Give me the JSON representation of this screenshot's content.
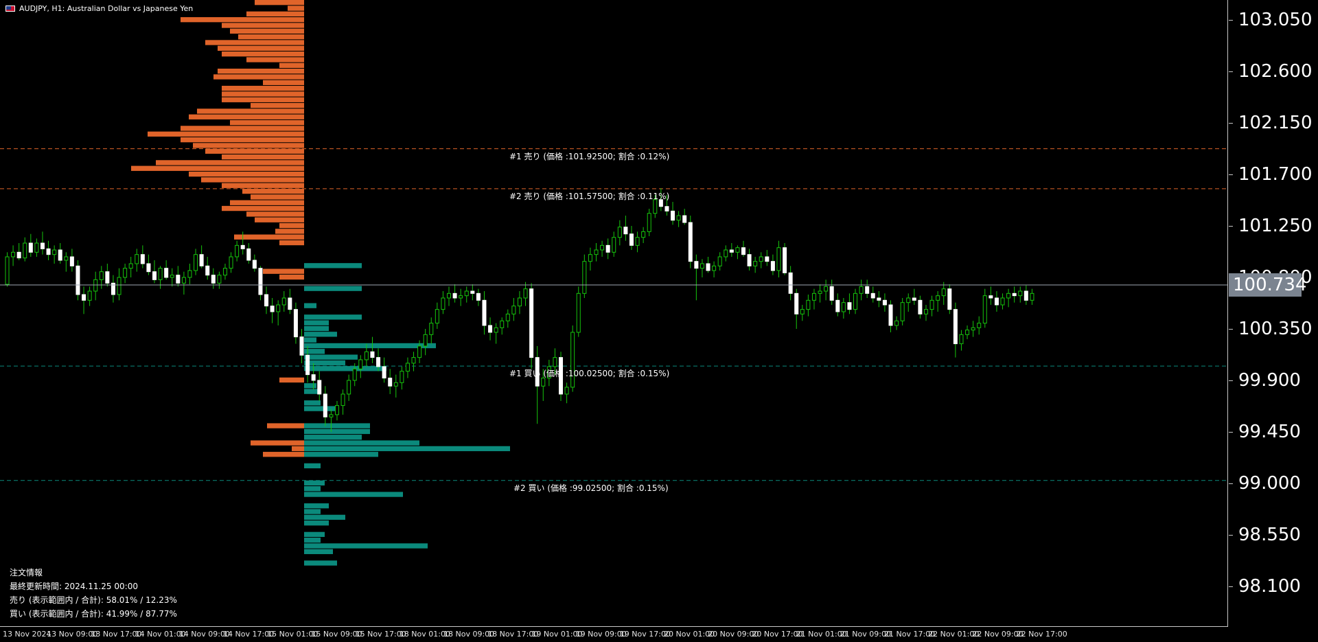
{
  "window": {
    "title": "AUDJPY, H1:  Australian Dollar vs Japanese Yen",
    "symbol_icon": "au-flag-icon"
  },
  "colors": {
    "sell": "#e0642a",
    "buy": "#0b8a7c",
    "bull_candle": "#000000",
    "bull_border": "#ffffff",
    "bear_candle": "#ffffff",
    "wick": "#16c60c",
    "grid_sell_line": "#e0642a",
    "grid_buy_line": "#0b8a7c",
    "current_price_line": "#a0a8b4",
    "background": "#000000"
  },
  "price_axis": {
    "labels": [
      "103.050",
      "102.600",
      "102.150",
      "101.700",
      "101.250",
      "100.800",
      "100.350",
      "99.900",
      "99.450",
      "99.000",
      "98.550",
      "98.100"
    ],
    "current_price": "100.734"
  },
  "time_axis": {
    "labels": [
      "13 Nov 2024",
      "13 Nov 09:00",
      "13 Nov 17:00",
      "14 Nov 01:00",
      "14 Nov 09:00",
      "14 Nov 17:00",
      "15 Nov 01:00",
      "15 Nov 09:00",
      "15 Nov 17:00",
      "18 Nov 01:00",
      "18 Nov 09:00",
      "18 Nov 17:00",
      "19 Nov 01:00",
      "19 Nov 09:00",
      "19 Nov 17:00",
      "20 Nov 01:00",
      "20 Nov 09:00",
      "20 Nov 17:00",
      "21 Nov 01:00",
      "21 Nov 09:00",
      "21 Nov 17:00",
      "22 Nov 01:00",
      "22 Nov 09:00",
      "22 Nov 17:00"
    ]
  },
  "order_lines": [
    {
      "text": "#1 売り (価格 :101.92500; 割合 :0.12%)",
      "price": 101.925,
      "side": "sell"
    },
    {
      "text": "#2 売り (価格 :101.57500; 割合 :0.11%)",
      "price": 101.575,
      "side": "sell"
    },
    {
      "text": "#1 買い (価格 :100.02500; 割合 :0.15%)",
      "price": 100.025,
      "side": "buy"
    },
    {
      "text": "#2 買い (価格 :99.02500; 割合 :0.15%)",
      "price": 99.025,
      "side": "buy"
    }
  ],
  "info_panel": {
    "heading": "注文情報",
    "last_update": "最終更新時間: 2024.11.25 00:00",
    "sell_summary": "売り (表示範囲内 / 合計): 58.01% / 12.23%",
    "buy_summary": "買い (表示範囲内 / 合計): 41.99% / 87.77%"
  },
  "order_book": {
    "price_top": 103.225,
    "step": 0.05,
    "sell_levels": [
      0.12,
      0.04,
      0.14,
      0.3,
      0.2,
      0.18,
      0.16,
      0.24,
      0.21,
      0.2,
      0.14,
      0.06,
      0.21,
      0.22,
      0.1,
      0.2,
      0.2,
      0.2,
      0.13,
      0.26,
      0.28,
      0.18,
      0.3,
      0.38,
      0.3,
      0.27,
      0.24,
      0.2,
      0.36,
      0.42,
      0.28,
      0.25,
      0.2,
      0.15,
      0.13,
      0.18,
      0.2,
      0.14,
      0.12,
      0.06,
      0.07,
      0.17,
      0.06,
      0.0,
      0.0,
      0.0,
      0.0,
      0.1,
      0.06,
      0.0,
      0.0,
      0.0,
      0.0,
      0.0,
      0.0,
      0.0,
      0.0,
      0.0,
      0.0,
      0.0,
      0.0,
      0.0,
      0.0,
      0.0,
      0.0,
      0.0,
      0.06,
      0.0,
      0.0,
      0.0,
      0.0,
      0.0,
      0.0,
      0.0,
      0.09,
      0.0,
      0.0,
      0.13,
      0.03,
      0.1,
      0.0,
      0.0,
      0.0,
      0.0,
      0.0,
      0.0,
      0.0,
      0.0,
      0.0,
      0.0,
      0.0,
      0.0,
      0.0,
      0.0,
      0.0,
      0.0,
      0.0,
      0.0,
      0.0,
      0.0,
      0.0,
      0.0,
      0.0,
      0.0,
      0.0,
      0.0,
      0.0,
      0.0,
      0.0,
      0.0,
      0.02
    ],
    "buy_levels": [
      0.0,
      0.0,
      0.0,
      0.0,
      0.0,
      0.0,
      0.0,
      0.0,
      0.0,
      0.0,
      0.0,
      0.0,
      0.0,
      0.0,
      0.0,
      0.0,
      0.0,
      0.0,
      0.0,
      0.0,
      0.0,
      0.0,
      0.0,
      0.0,
      0.0,
      0.0,
      0.0,
      0.0,
      0.0,
      0.0,
      0.0,
      0.0,
      0.0,
      0.0,
      0.0,
      0.0,
      0.0,
      0.0,
      0.0,
      0.0,
      0.0,
      0.0,
      0.0,
      0.0,
      0.0,
      0.0,
      0.14,
      0.0,
      0.0,
      0.0,
      0.14,
      0.0,
      0.0,
      0.03,
      0.0,
      0.14,
      0.06,
      0.06,
      0.08,
      0.03,
      0.32,
      0.05,
      0.13,
      0.1,
      0.2,
      0.0,
      0.0,
      0.03,
      0.04,
      0.0,
      0.04,
      0.08,
      0.0,
      0.0,
      0.16,
      0.16,
      0.14,
      0.28,
      0.5,
      0.18,
      0.0,
      0.04,
      0.0,
      0.0,
      0.05,
      0.04,
      0.24,
      0.0,
      0.06,
      0.04,
      0.1,
      0.06,
      0.0,
      0.05,
      0.04,
      0.3,
      0.07,
      0.0,
      0.08
    ],
    "max_fraction": 0.5,
    "max_width": 300
  },
  "candles": [
    [
      100.74,
      101.02,
      100.72,
      100.98
    ],
    [
      100.98,
      101.08,
      100.9,
      101.02
    ],
    [
      101.02,
      101.1,
      100.95,
      100.97
    ],
    [
      100.97,
      101.15,
      100.94,
      101.1
    ],
    [
      101.1,
      101.18,
      100.98,
      101.02
    ],
    [
      101.02,
      101.14,
      100.98,
      101.1
    ],
    [
      101.1,
      101.2,
      101.0,
      101.05
    ],
    [
      101.05,
      101.12,
      100.95,
      101.0
    ],
    [
      101.0,
      101.08,
      100.92,
      101.04
    ],
    [
      101.04,
      101.1,
      100.92,
      100.95
    ],
    [
      100.95,
      101.02,
      100.85,
      100.98
    ],
    [
      100.98,
      101.05,
      100.85,
      100.9
    ],
    [
      100.9,
      100.95,
      100.6,
      100.65
    ],
    [
      100.65,
      100.72,
      100.48,
      100.6
    ],
    [
      100.6,
      100.72,
      100.55,
      100.68
    ],
    [
      100.68,
      100.85,
      100.6,
      100.78
    ],
    [
      100.78,
      100.9,
      100.7,
      100.85
    ],
    [
      100.85,
      100.92,
      100.72,
      100.75
    ],
    [
      100.75,
      100.82,
      100.58,
      100.65
    ],
    [
      100.65,
      100.88,
      100.6,
      100.8
    ],
    [
      100.8,
      100.92,
      100.75,
      100.88
    ],
    [
      100.88,
      100.98,
      100.8,
      100.92
    ],
    [
      100.92,
      101.05,
      100.85,
      101.0
    ],
    [
      101.0,
      101.08,
      100.88,
      100.92
    ],
    [
      100.92,
      101.0,
      100.82,
      100.85
    ],
    [
      100.85,
      100.95,
      100.75,
      100.78
    ],
    [
      100.78,
      100.9,
      100.7,
      100.88
    ],
    [
      100.88,
      100.95,
      100.78,
      100.8
    ],
    [
      100.8,
      100.88,
      100.72,
      100.82
    ],
    [
      100.82,
      100.9,
      100.72,
      100.75
    ],
    [
      100.75,
      100.85,
      100.65,
      100.8
    ],
    [
      100.8,
      100.92,
      100.74,
      100.86
    ],
    [
      100.86,
      101.05,
      100.82,
      101.0
    ],
    [
      101.0,
      101.08,
      100.88,
      100.9
    ],
    [
      100.9,
      100.98,
      100.78,
      100.82
    ],
    [
      100.82,
      100.88,
      100.7,
      100.75
    ],
    [
      100.75,
      100.85,
      100.7,
      100.82
    ],
    [
      100.82,
      100.92,
      100.78,
      100.88
    ],
    [
      100.88,
      101.02,
      100.84,
      100.98
    ],
    [
      100.98,
      101.12,
      100.94,
      101.08
    ],
    [
      101.08,
      101.2,
      101.0,
      101.05
    ],
    [
      101.05,
      101.1,
      100.92,
      100.95
    ],
    [
      100.95,
      101.0,
      100.85,
      100.88
    ],
    [
      100.88,
      100.9,
      100.6,
      100.65
    ],
    [
      100.65,
      100.72,
      100.48,
      100.55
    ],
    [
      100.55,
      100.62,
      100.4,
      100.5
    ],
    [
      100.5,
      100.6,
      100.38,
      100.56
    ],
    [
      100.56,
      100.68,
      100.5,
      100.62
    ],
    [
      100.62,
      100.7,
      100.48,
      100.52
    ],
    [
      100.52,
      100.58,
      100.22,
      100.28
    ],
    [
      100.28,
      100.35,
      100.05,
      100.12
    ],
    [
      100.12,
      100.2,
      99.88,
      99.95
    ],
    [
      99.95,
      100.05,
      99.82,
      99.9
    ],
    [
      99.9,
      99.98,
      99.72,
      99.78
    ],
    [
      99.78,
      99.85,
      99.5,
      99.58
    ],
    [
      99.58,
      99.65,
      99.45,
      99.6
    ],
    [
      99.6,
      99.72,
      99.55,
      99.68
    ],
    [
      99.68,
      99.82,
      99.6,
      99.78
    ],
    [
      99.78,
      99.95,
      99.72,
      99.9
    ],
    [
      99.9,
      100.05,
      99.85,
      100.0
    ],
    [
      100.0,
      100.12,
      99.92,
      100.08
    ],
    [
      100.08,
      100.22,
      100.02,
      100.15
    ],
    [
      100.15,
      100.28,
      100.05,
      100.1
    ],
    [
      100.1,
      100.18,
      99.98,
      100.02
    ],
    [
      100.02,
      100.1,
      99.88,
      99.92
    ],
    [
      99.92,
      100.0,
      99.78,
      99.85
    ],
    [
      99.85,
      99.95,
      99.75,
      99.88
    ],
    [
      99.88,
      100.02,
      99.82,
      99.98
    ],
    [
      99.98,
      100.1,
      99.92,
      100.05
    ],
    [
      100.05,
      100.15,
      99.98,
      100.1
    ],
    [
      100.1,
      100.25,
      100.05,
      100.2
    ],
    [
      100.2,
      100.35,
      100.12,
      100.3
    ],
    [
      100.3,
      100.45,
      100.22,
      100.4
    ],
    [
      100.4,
      100.58,
      100.35,
      100.52
    ],
    [
      100.52,
      100.68,
      100.48,
      100.62
    ],
    [
      100.62,
      100.72,
      100.55,
      100.66
    ],
    [
      100.66,
      100.74,
      100.58,
      100.62
    ],
    [
      100.62,
      100.7,
      100.55,
      100.64
    ],
    [
      100.64,
      100.72,
      100.58,
      100.68
    ],
    [
      100.68,
      100.74,
      100.6,
      100.66
    ],
    [
      100.66,
      100.7,
      100.55,
      100.6
    ],
    [
      100.6,
      100.68,
      100.3,
      100.38
    ],
    [
      100.38,
      100.45,
      100.25,
      100.32
    ],
    [
      100.32,
      100.4,
      100.22,
      100.36
    ],
    [
      100.36,
      100.45,
      100.3,
      100.42
    ],
    [
      100.42,
      100.52,
      100.36,
      100.48
    ],
    [
      100.48,
      100.62,
      100.42,
      100.55
    ],
    [
      100.55,
      100.68,
      100.48,
      100.62
    ],
    [
      100.62,
      100.76,
      100.55,
      100.7
    ],
    [
      100.7,
      100.75,
      100.0,
      100.1
    ],
    [
      100.1,
      100.2,
      99.52,
      99.85
    ],
    [
      99.85,
      100.0,
      99.72,
      99.92
    ],
    [
      99.92,
      100.08,
      99.85,
      100.02
    ],
    [
      100.02,
      100.18,
      99.95,
      100.1
    ],
    [
      100.1,
      100.15,
      99.72,
      99.78
    ],
    [
      99.78,
      99.88,
      99.7,
      99.84
    ],
    [
      99.84,
      100.38,
      99.8,
      100.32
    ],
    [
      100.32,
      100.72,
      100.28,
      100.66
    ],
    [
      100.66,
      101.0,
      100.62,
      100.94
    ],
    [
      100.94,
      101.06,
      100.86,
      101.0
    ],
    [
      101.0,
      101.1,
      100.94,
      101.04
    ],
    [
      101.04,
      101.12,
      100.98,
      101.08
    ],
    [
      101.08,
      101.14,
      100.96,
      101.02
    ],
    [
      101.02,
      101.2,
      100.98,
      101.15
    ],
    [
      101.15,
      101.3,
      101.08,
      101.24
    ],
    [
      101.24,
      101.34,
      101.12,
      101.18
    ],
    [
      101.18,
      101.25,
      101.04,
      101.08
    ],
    [
      101.08,
      101.2,
      101.02,
      101.15
    ],
    [
      101.15,
      101.24,
      101.1,
      101.2
    ],
    [
      101.2,
      101.4,
      101.16,
      101.36
    ],
    [
      101.36,
      101.52,
      101.32,
      101.48
    ],
    [
      101.48,
      101.58,
      101.38,
      101.42
    ],
    [
      101.42,
      101.52,
      101.34,
      101.38
    ],
    [
      101.38,
      101.46,
      101.26,
      101.3
    ],
    [
      101.3,
      101.38,
      101.24,
      101.34
    ],
    [
      101.34,
      101.4,
      101.26,
      101.28
    ],
    [
      101.28,
      101.34,
      100.88,
      100.94
    ],
    [
      100.94,
      101.0,
      100.6,
      100.88
    ],
    [
      100.88,
      100.96,
      100.8,
      100.92
    ],
    [
      100.92,
      100.98,
      100.84,
      100.86
    ],
    [
      100.86,
      100.94,
      100.8,
      100.9
    ],
    [
      100.9,
      101.02,
      100.86,
      100.98
    ],
    [
      100.98,
      101.08,
      100.94,
      101.04
    ],
    [
      101.04,
      101.1,
      100.98,
      101.02
    ],
    [
      101.02,
      101.08,
      100.96,
      101.06
    ],
    [
      101.06,
      101.12,
      100.98,
      101.0
    ],
    [
      101.0,
      101.05,
      100.86,
      100.9
    ],
    [
      100.9,
      100.98,
      100.84,
      100.94
    ],
    [
      100.94,
      101.02,
      100.88,
      100.98
    ],
    [
      100.98,
      101.04,
      100.9,
      100.94
    ],
    [
      100.94,
      101.0,
      100.82,
      100.86
    ],
    [
      100.86,
      101.12,
      100.8,
      101.06
    ],
    [
      101.06,
      101.1,
      100.82,
      100.84
    ],
    [
      100.84,
      100.9,
      100.6,
      100.66
    ],
    [
      100.66,
      100.7,
      100.35,
      100.48
    ],
    [
      100.48,
      100.56,
      100.42,
      100.52
    ],
    [
      100.52,
      100.65,
      100.46,
      100.6
    ],
    [
      100.6,
      100.7,
      100.52,
      100.66
    ],
    [
      100.66,
      100.74,
      100.58,
      100.68
    ],
    [
      100.68,
      100.78,
      100.6,
      100.72
    ],
    [
      100.72,
      100.78,
      100.56,
      100.6
    ],
    [
      100.6,
      100.66,
      100.46,
      100.5
    ],
    [
      100.5,
      100.62,
      100.44,
      100.58
    ],
    [
      100.58,
      100.66,
      100.48,
      100.52
    ],
    [
      100.52,
      100.7,
      100.48,
      100.66
    ],
    [
      100.66,
      100.78,
      100.6,
      100.72
    ],
    [
      100.72,
      100.78,
      100.62,
      100.66
    ],
    [
      100.66,
      100.72,
      100.58,
      100.62
    ],
    [
      100.62,
      100.68,
      100.54,
      100.6
    ],
    [
      100.6,
      100.66,
      100.5,
      100.56
    ],
    [
      100.56,
      100.6,
      100.32,
      100.38
    ],
    [
      100.38,
      100.46,
      100.34,
      100.42
    ],
    [
      100.42,
      100.62,
      100.38,
      100.58
    ],
    [
      100.58,
      100.66,
      100.5,
      100.62
    ],
    [
      100.62,
      100.7,
      100.56,
      100.6
    ],
    [
      100.6,
      100.64,
      100.44,
      100.48
    ],
    [
      100.48,
      100.56,
      100.42,
      100.52
    ],
    [
      100.52,
      100.64,
      100.46,
      100.6
    ],
    [
      100.6,
      100.68,
      100.5,
      100.64
    ],
    [
      100.64,
      100.76,
      100.56,
      100.7
    ],
    [
      100.7,
      100.74,
      100.48,
      100.52
    ],
    [
      100.52,
      100.58,
      100.1,
      100.22
    ],
    [
      100.22,
      100.34,
      100.16,
      100.3
    ],
    [
      100.3,
      100.38,
      100.26,
      100.34
    ],
    [
      100.34,
      100.42,
      100.28,
      100.36
    ],
    [
      100.36,
      100.46,
      100.3,
      100.4
    ],
    [
      100.4,
      100.7,
      100.36,
      100.64
    ],
    [
      100.64,
      100.72,
      100.56,
      100.62
    ],
    [
      100.62,
      100.68,
      100.5,
      100.56
    ],
    [
      100.56,
      100.66,
      100.52,
      100.62
    ],
    [
      100.62,
      100.7,
      100.54,
      100.66
    ],
    [
      100.66,
      100.72,
      100.58,
      100.64
    ],
    [
      100.64,
      100.72,
      100.58,
      100.68
    ],
    [
      100.68,
      100.73,
      100.56,
      100.6
    ],
    [
      100.6,
      100.7,
      100.56,
      100.66
    ]
  ]
}
